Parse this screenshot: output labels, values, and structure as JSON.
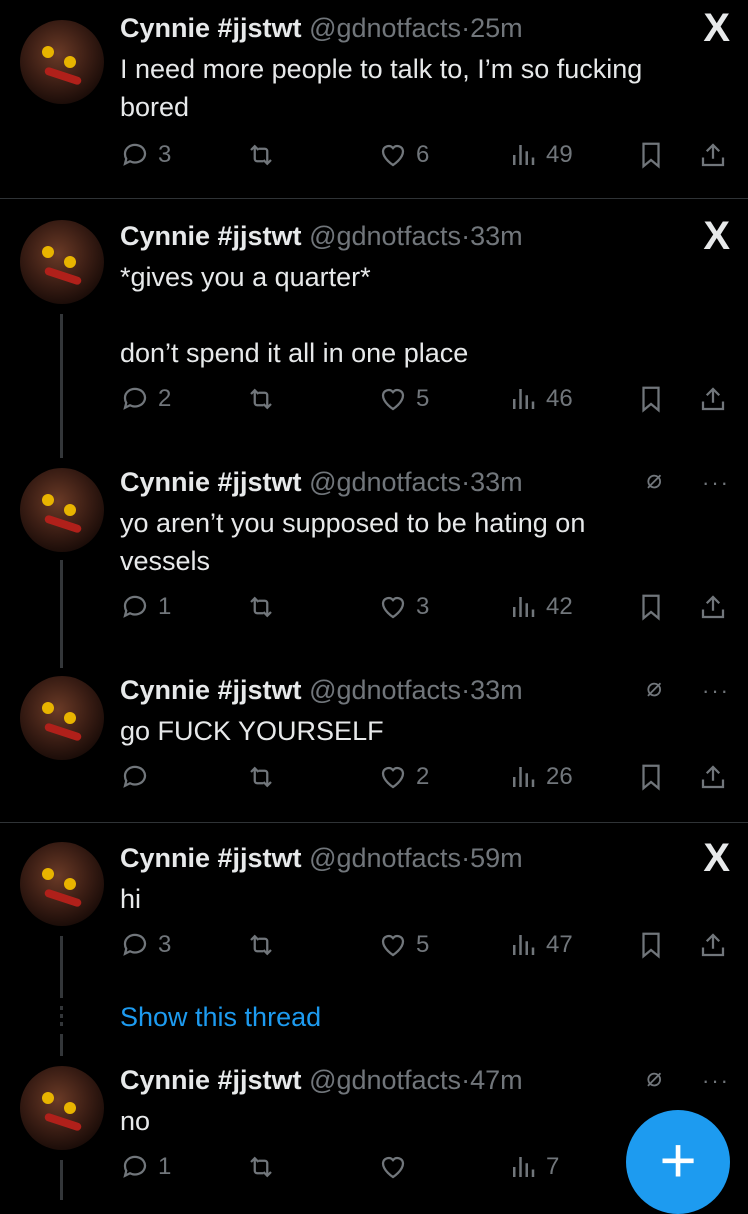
{
  "tweets": [
    {
      "name": "Cynnie #jjstwt",
      "handle": "@gdnotfacts",
      "sep": "·",
      "time": "25m",
      "text": "I need more people to talk to, I’m so fucking\nbored",
      "corner": "X",
      "replies": "3",
      "likes": "6",
      "views": "49"
    },
    {
      "name": "Cynnie #jjstwt",
      "handle": "@gdnotfacts",
      "sep": "·",
      "time": "33m",
      "text": "*gives you a quarter*\n\ndon’t spend it all in one place",
      "corner": "X",
      "replies": "2",
      "likes": "5",
      "views": "46"
    },
    {
      "name": "Cynnie #jjstwt",
      "handle": "@gdnotfacts",
      "sep": "·",
      "time": "33m",
      "text": "yo aren’t you supposed to be hating on\nvessels",
      "corner": "⌀",
      "more": "···",
      "replies": "1",
      "likes": "3",
      "views": "42"
    },
    {
      "name": "Cynnie #jjstwt",
      "handle": "@gdnotfacts",
      "sep": "·",
      "time": "33m",
      "text": "go FUCK YOURSELF",
      "corner": "⌀",
      "more": "···",
      "replies": "",
      "likes": "2",
      "views": "26"
    },
    {
      "name": "Cynnie #jjstwt",
      "handle": "@gdnotfacts",
      "sep": "·",
      "time": "59m",
      "text": "hi",
      "corner": "X",
      "replies": "3",
      "likes": "5",
      "views": "47"
    },
    {
      "name": "Cynnie #jjstwt",
      "handle": "@gdnotfacts",
      "sep": "·",
      "time": "47m",
      "text": "no",
      "corner": "⌀",
      "more": "···",
      "replies": "1",
      "likes": "",
      "views": "7"
    }
  ],
  "show_thread": "Show this thread",
  "fab_label": "+",
  "icons": [
    "reply-icon",
    "retweet-icon",
    "like-icon",
    "views-icon",
    "bookmark-icon",
    "share-icon",
    "x-logo-icon",
    "muted-icon",
    "more-icon"
  ],
  "colors": {
    "background": "#000000",
    "text": "#e7e9ea",
    "muted": "#71767b",
    "accent": "#1d9bf0",
    "divider": "#2f3336"
  }
}
